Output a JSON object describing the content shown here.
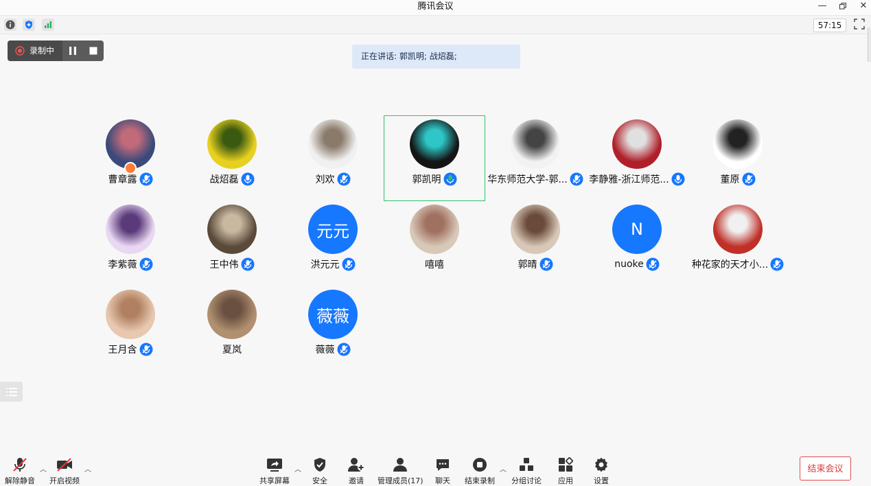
{
  "window": {
    "title": "腾讯会议"
  },
  "topbar": {
    "timer": "57:15"
  },
  "recording": {
    "label": "录制中"
  },
  "speaking": {
    "text": "正在讲话: 郭凯明; 战炤磊;"
  },
  "participants": [
    {
      "name": "曹章露",
      "avatar_text": ""
    },
    {
      "name": "战炤磊",
      "avatar_text": ""
    },
    {
      "name": "刘欢",
      "avatar_text": ""
    },
    {
      "name": "郭凯明",
      "avatar_text": ""
    },
    {
      "name": "华东师范大学-郭...",
      "avatar_text": ""
    },
    {
      "name": "李静雅-浙江师范...",
      "avatar_text": ""
    },
    {
      "name": "董原",
      "avatar_text": ""
    },
    {
      "name": "李紫薇",
      "avatar_text": ""
    },
    {
      "name": "王中伟",
      "avatar_text": ""
    },
    {
      "name": "洪元元",
      "avatar_text": "元元"
    },
    {
      "name": "嘻嘻",
      "avatar_text": ""
    },
    {
      "name": "郭晴",
      "avatar_text": ""
    },
    {
      "name": "nuoke",
      "avatar_text": "N"
    },
    {
      "name": "种花家的天才小...",
      "avatar_text": ""
    },
    {
      "name": "王月含",
      "avatar_text": ""
    },
    {
      "name": "夏岚",
      "avatar_text": ""
    },
    {
      "name": "薇薇",
      "avatar_text": "薇薇"
    }
  ],
  "toolbar": {
    "unmute": "解除静音",
    "start_video": "开启视频",
    "share_screen": "共享屏幕",
    "security": "安全",
    "invite": "邀请",
    "manage_members": "管理成员(17)",
    "chat": "聊天",
    "end_recording": "结束录制",
    "breakout": "分组讨论",
    "apps": "应用",
    "settings": "设置",
    "end_meeting": "结束会议"
  },
  "colors": {
    "accent": "#1677ff",
    "active_border": "#2fc26b",
    "danger": "#e04d4d"
  }
}
